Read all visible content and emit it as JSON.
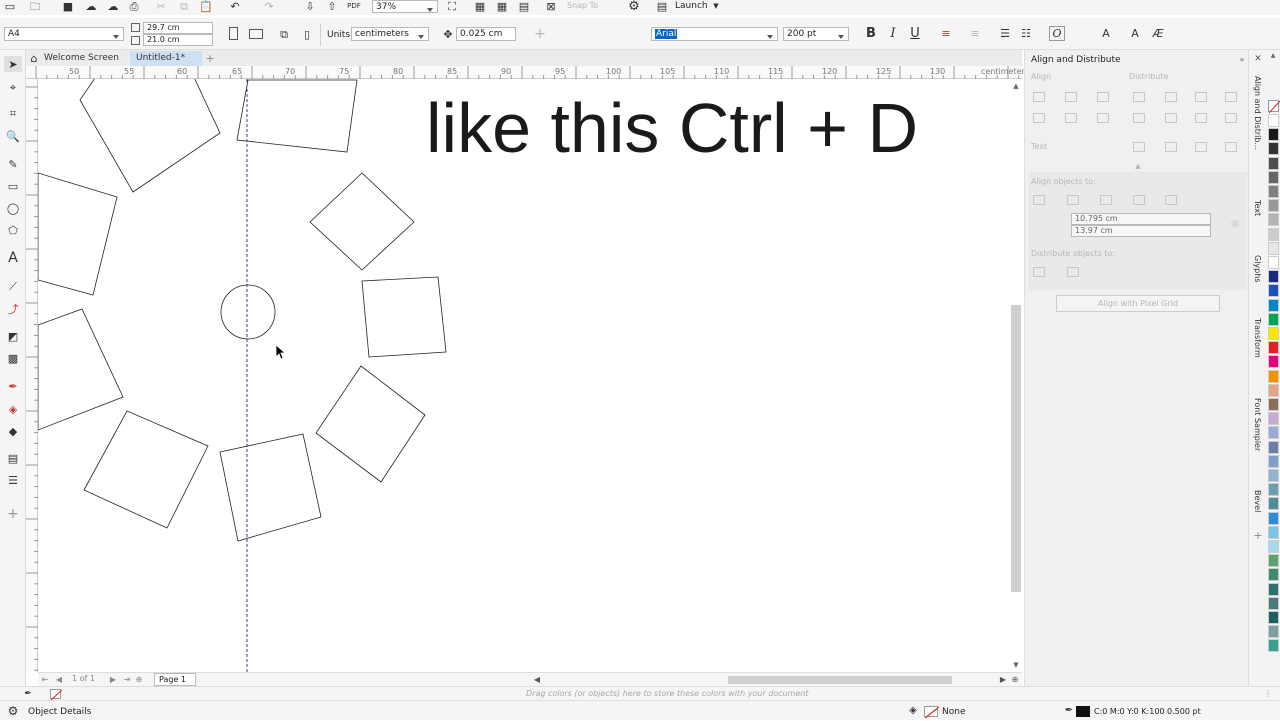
{
  "toolbar": {
    "zoom": "37%",
    "launch": "Launch",
    "snap_to": "Snap To"
  },
  "propertybar": {
    "page_size": "A4",
    "width": "29.7 cm",
    "height": "21.0 cm",
    "units_label": "Units:",
    "units_value": "centimeters",
    "nudge": "0.025 cm",
    "font_name": "Arial",
    "font_size": "200 pt"
  },
  "tabs": {
    "welcome": "Welcome Screen",
    "document": "Untitled-1*"
  },
  "ruler": {
    "numbers": [
      "50",
      "55",
      "60",
      "65",
      "70",
      "75",
      "80",
      "85",
      "90",
      "95",
      "100",
      "105",
      "110",
      "115",
      "120",
      "125",
      "130"
    ],
    "unit": "centimeters",
    "vertical_numbers": [
      "20",
      "25",
      "30",
      "35",
      "40",
      "45",
      "50",
      "55",
      "60",
      "65",
      "70",
      "75"
    ]
  },
  "canvas": {
    "text": "like this Ctrl + D"
  },
  "pagenav": {
    "of": "1 of 1",
    "page": "Page 1"
  },
  "docker": {
    "title": "Align and Distribute",
    "align": "Align",
    "distribute": "Distribute",
    "text_label": "Text",
    "align_objects_to": "Align objects to:",
    "x_value": "10.795 cm",
    "y_value": "13.97 cm",
    "distribute_objects_to": "Distribute objects to:",
    "pixel_grid_button": "Align with Pixel Grid"
  },
  "side_tabs": [
    "Align and Distrib...",
    "Text",
    "Glyphs",
    "Transform",
    "Font Sampler",
    "Bevel"
  ],
  "color_hint": "Drag colors (or objects) here to store these colors with your document",
  "status": {
    "object_details": "Object Details",
    "fill": "None",
    "outline": "C:0 M:0 Y:0 K:100  0.500 pt"
  },
  "palette_colors": [
    "#ffffff",
    "#1a1a1a",
    "#333333",
    "#4d4d4d",
    "#666666",
    "#808080",
    "#999999",
    "#b3b3b3",
    "#cccccc",
    "#e6e6e6",
    "#ffffff",
    "#1b2a7a",
    "#1e4fbf",
    "#0089c6",
    "#00a651",
    "#ffe600",
    "#e31e24",
    "#e4007c",
    "#f39200",
    "#e8a287",
    "#8a6e56",
    "#c7a9d6",
    "#9aa9d8",
    "#6c7fa8",
    "#7ca0c8",
    "#90b4d0",
    "#6aa0b0",
    "#4e8e98",
    "#2a8fd8",
    "#7ac4e8",
    "#a8d8ec",
    "#5aa36a",
    "#3c8c6c",
    "#2f6f6f",
    "#4a7a7a",
    "#1f5f5f",
    "#7fa0a0",
    "#39a08a"
  ]
}
